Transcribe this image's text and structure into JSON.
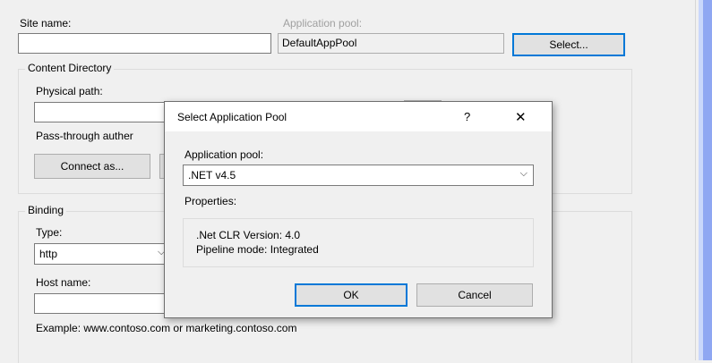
{
  "main": {
    "site_name_label": "Site name:",
    "site_name_value": "",
    "app_pool_label": "Application pool:",
    "app_pool_value": "DefaultAppPool",
    "select_button": "Select...",
    "content_directory_legend": "Content Directory",
    "physical_path_label": "Physical path:",
    "physical_path_value": "",
    "browse_button": "...",
    "pass_through_label": "Pass-through auther",
    "connect_as_button": "Connect as...",
    "binding_legend": "Binding",
    "type_label": "Type:",
    "type_value": "http",
    "host_name_label": "Host name:",
    "host_name_value": "",
    "example_text": "Example: www.contoso.com or marketing.contoso.com"
  },
  "dialog": {
    "title": "Select Application Pool",
    "help_glyph": "?",
    "close_glyph": "✕",
    "app_pool_label": "Application pool:",
    "app_pool_selected": ".NET v4.5",
    "properties_label": "Properties:",
    "clr_version": ".Net CLR Version: 4.0",
    "pipeline_mode": "Pipeline mode: Integrated",
    "ok_button": "OK",
    "cancel_button": "Cancel"
  },
  "icons": {
    "chevron": "⌵"
  },
  "colors": {
    "accent": "#0078d7",
    "window_bg": "#f0f0f0",
    "disabled_text": "#a0a0a0",
    "scroll_strip": "#8fa7f2"
  }
}
